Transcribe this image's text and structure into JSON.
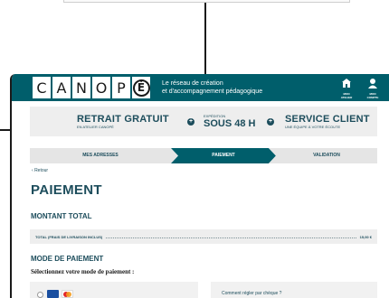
{
  "header": {
    "logo_letters": [
      "C",
      "A",
      "N",
      "O",
      "P",
      "É"
    ],
    "tagline_line1": "Le réseau de création",
    "tagline_line2": "et d'accompagnement pédagogique",
    "icons": [
      {
        "icon": "store-icon",
        "line1": "MON",
        "line2": "ATELIER"
      },
      {
        "icon": "user-icon",
        "line1": "MON",
        "line2": "COMPTE"
      }
    ]
  },
  "services": {
    "pickup_title": "RETRAIT GRATUIT",
    "pickup_sub": "EN ATELIER CANOPÉ",
    "shipping_small": "EXPÉDITION",
    "shipping_big": "SOUS 48 H",
    "support_title": "SERVICE CLIENT",
    "support_sub": "UNE ÉQUIPE À VOTRE ÉCOUTE"
  },
  "steps": [
    "MES ADRESSES",
    "PAIEMENT",
    "VALIDATION"
  ],
  "back_label": "Retour",
  "page_title": "PAIEMENT",
  "total": {
    "section_title": "MONTANT TOTAL",
    "label": "TOTAL (FRAIS DE LIVRAISON INCLUS)",
    "amount": "15,00 €"
  },
  "payment": {
    "section_title": "MODE DE PAIEMENT",
    "instruction": "Sélectionnez votre mode de paiement :",
    "help_text": "Comment régler par chèque ?"
  },
  "colors": {
    "header_bg": "#005e6b",
    "text_primary": "#1d4d5c",
    "step_active": "#005e6b",
    "step_inactive": "#e5e5e5"
  }
}
